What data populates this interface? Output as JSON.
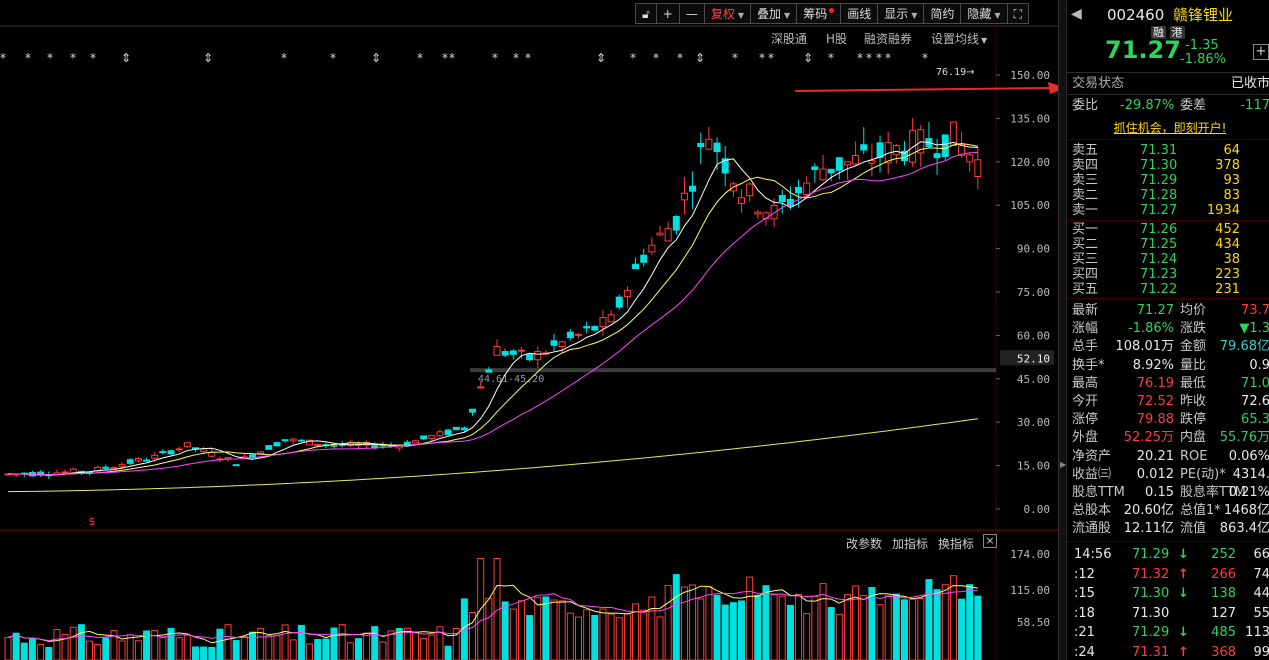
{
  "toolbar": {
    "lock_icon": "lock-icon",
    "plus": "+",
    "minus": "—",
    "fuquan": "复权",
    "diejia": "叠加",
    "chouma": "筹码",
    "huaxian": "画线",
    "xianshi": "显示",
    "jianyue": "简约",
    "yincang": "隐藏",
    "fullscreen_icon": "expand-icon"
  },
  "subtoolbar": {
    "shengutong": "深股通",
    "hgu": "H股",
    "rongzi": "融资融券",
    "shezhi": "设置均线"
  },
  "markers": {
    "star": "*",
    "arrow": "⇕",
    "dollar": "$"
  },
  "price_axis": [
    "150.00",
    "135.00",
    "120.00",
    "105.00",
    "90.00",
    "75.00",
    "60.00",
    "45.00",
    "30.00",
    "15.00",
    "0.00"
  ],
  "price_axis_highlight": "52.10",
  "annotations": {
    "high_label": "76.19",
    "range_label": "44.61-45.20"
  },
  "volume": {
    "toolbar": {
      "gaicanshu": "改参数",
      "jiazhibiao": "加指标",
      "huanzhibiao": "换指标",
      "close": "×"
    },
    "axis": [
      "174.00",
      "115.00",
      "58.50"
    ]
  },
  "colors": {
    "up": "#ff3b3b",
    "down": "#00e0e0",
    "ma5": "#ffffff",
    "ma10": "#ffff66",
    "ma20": "#ff44ff",
    "ma60": "#e8e860",
    "arrow": "#e82a2a"
  },
  "quote": {
    "code": "002460",
    "name": "赣锋锂业",
    "badge_rong": "融",
    "badge_gang": "港",
    "price": "71.27",
    "change": "-1.35",
    "change_pct": "-1.86%",
    "status_label": "交易状态",
    "status_value": "已收市",
    "weibi_label": "委比",
    "weibi_value": "-29.87%",
    "weicha_label": "委差",
    "weicha_value": "-117",
    "promo": "抓住机会，即刻开户!"
  },
  "asks": [
    {
      "label": "卖五",
      "price": "71.31",
      "vol": "64"
    },
    {
      "label": "卖四",
      "price": "71.30",
      "vol": "378"
    },
    {
      "label": "卖三",
      "price": "71.29",
      "vol": "93"
    },
    {
      "label": "卖二",
      "price": "71.28",
      "vol": "83"
    },
    {
      "label": "卖一",
      "price": "71.27",
      "vol": "1934"
    }
  ],
  "bids": [
    {
      "label": "买一",
      "price": "71.26",
      "vol": "452"
    },
    {
      "label": "买二",
      "price": "71.25",
      "vol": "434"
    },
    {
      "label": "买三",
      "price": "71.24",
      "vol": "38"
    },
    {
      "label": "买四",
      "price": "71.23",
      "vol": "223"
    },
    {
      "label": "买五",
      "price": "71.22",
      "vol": "231"
    }
  ],
  "stats": [
    {
      "l1": "最新",
      "v1": "71.27",
      "c1": "green",
      "l2": "均价",
      "v2": "73.7",
      "c2": "red"
    },
    {
      "l1": "涨幅",
      "v1": "-1.86%",
      "c1": "green",
      "l2": "涨跌",
      "v2": "▼1.3",
      "c2": "green"
    },
    {
      "l1": "总手",
      "v1": "108.01万",
      "c1": "white",
      "l2": "金额",
      "v2": "79.68亿",
      "c2": "cyan"
    },
    {
      "l1": "换手*",
      "v1": "8.92%",
      "c1": "white",
      "l2": "量比",
      "v2": "0.9",
      "c2": "white"
    },
    {
      "l1": "最高",
      "v1": "76.19",
      "c1": "red",
      "l2": "最低",
      "v2": "71.0",
      "c2": "green"
    },
    {
      "l1": "今开",
      "v1": "72.52",
      "c1": "red",
      "l2": "昨收",
      "v2": "72.6",
      "c2": "white"
    },
    {
      "l1": "涨停",
      "v1": "79.88",
      "c1": "red",
      "l2": "跌停",
      "v2": "65.3",
      "c2": "green"
    },
    {
      "l1": "外盘",
      "v1": "52.25万",
      "c1": "red",
      "l2": "内盘",
      "v2": "55.76万",
      "c2": "green"
    },
    {
      "l1": "净资产",
      "v1": "20.21",
      "c1": "white",
      "l2": "ROE",
      "v2": "0.06%",
      "c2": "white"
    },
    {
      "l1": "收益㈢",
      "v1": "0.012",
      "c1": "white",
      "l2": "PE(动)*",
      "v2": "4314.",
      "c2": "white"
    },
    {
      "l1": "股息TTM",
      "v1": "0.15",
      "c1": "white",
      "l2": "股息率TTM",
      "v2": "0.21%",
      "c2": "white"
    },
    {
      "l1": "总股本",
      "v1": "20.60亿",
      "c1": "white",
      "l2": "总值1*",
      "v2": "1468亿",
      "c2": "white"
    },
    {
      "l1": "流通股",
      "v1": "12.11亿",
      "c1": "white",
      "l2": "流值",
      "v2": "863.4亿",
      "c2": "white"
    }
  ],
  "ticks": [
    {
      "time": "14:56",
      "price": "71.29",
      "dir": "↓",
      "vol": "252",
      "extra": "66"
    },
    {
      "time": ":12",
      "price": "71.32",
      "dir": "↑",
      "vol": "266",
      "extra": "74"
    },
    {
      "time": ":15",
      "price": "71.30",
      "dir": "↓",
      "vol": "138",
      "extra": "44"
    },
    {
      "time": ":18",
      "price": "71.30",
      "dir": "",
      "vol": "127",
      "extra": "55"
    },
    {
      "time": ":21",
      "price": "71.29",
      "dir": "↓",
      "vol": "485",
      "extra": "113"
    },
    {
      "time": ":24",
      "price": "71.31",
      "dir": "↑",
      "vol": "368",
      "extra": "99"
    }
  ]
}
